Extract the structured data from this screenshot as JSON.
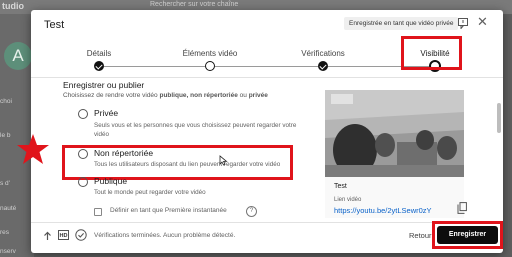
{
  "background": {
    "logo": "tudio",
    "search_placeholder": "Rechercher sur votre chaîne",
    "avatar_letter": "A",
    "nav_items": [
      "choi",
      "le b",
      "s d'",
      "nauté",
      "res",
      "nserv"
    ]
  },
  "modal": {
    "title": "Test",
    "saved_badge": "Enregistrée en tant que vidéo privée",
    "steps": [
      {
        "label": "Détails",
        "state": "done"
      },
      {
        "label": "Éléments vidéo",
        "state": "empty"
      },
      {
        "label": "Vérifications",
        "state": "done"
      },
      {
        "label": "Visibilité",
        "state": "current"
      }
    ],
    "section": {
      "title": "Enregistrer ou publier",
      "subtitle_pre": "Choisissez de rendre votre vidéo ",
      "subtitle_bold": "publique, non répertoriée",
      "subtitle_mid": " ou ",
      "subtitle_bold2": "privée"
    },
    "options": [
      {
        "label": "Privée",
        "description": "Seuls vous et les personnes que vous choisissez peuvent regarder votre vidéo"
      },
      {
        "label": "Non répertoriée",
        "description": "Tous les utilisateurs disposant du lien peuvent regarder votre vidéo"
      },
      {
        "label": "Publique",
        "description": "Tout le monde peut regarder votre vidéo"
      }
    ],
    "premiere_checkbox_label": "Définir en tant que Première instantanée",
    "preview": {
      "title": "Test",
      "link_label": "Lien vidéo",
      "link_value": "https://youtu.be/2ytLSewr0zY"
    },
    "footer": {
      "status": "Vérifications terminées. Aucun problème détecté.",
      "hd_badge": "HD",
      "back_label": "Retour",
      "save_label": "Enregistrer"
    }
  },
  "colors": {
    "highlight": "#e0141b",
    "link": "#0a62c9",
    "save_button": "#0d0d0d"
  }
}
